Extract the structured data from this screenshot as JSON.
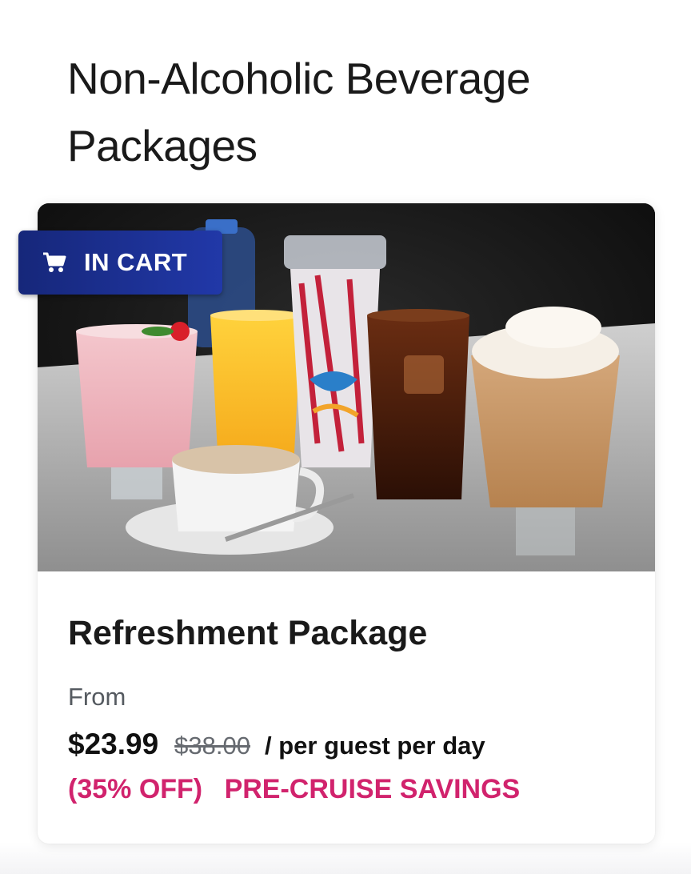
{
  "section": {
    "title": "Non-Alcoholic Beverage Packages"
  },
  "badge": {
    "icon": "shopping-cart-icon",
    "label": "IN CART",
    "color": "#1c2f96"
  },
  "card": {
    "image_alt": "Assorted non-alcoholic beverages",
    "package_name": "Refreshment Package",
    "from_label": "From",
    "price": "$23.99",
    "original_price": "$38.00",
    "price_unit": "/ per guest per day",
    "discount": "(35% OFF)",
    "savings_label": "PRE-CRUISE SAVINGS",
    "accent_color": "#d1236d"
  }
}
